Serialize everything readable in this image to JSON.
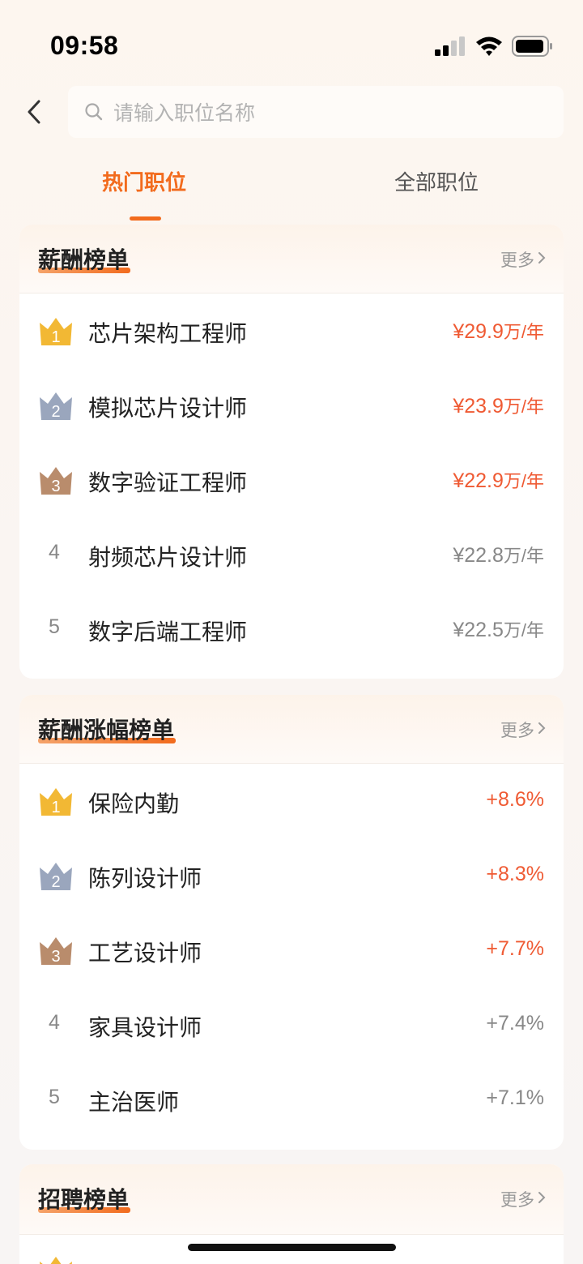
{
  "status_bar": {
    "time": "09:58"
  },
  "search": {
    "placeholder": "请输入职位名称"
  },
  "tabs": [
    {
      "label": "热门职位",
      "active": true
    },
    {
      "label": "全部职位",
      "active": false
    }
  ],
  "colors": {
    "accent": "#f26b1d",
    "value_hot": "#ef5a33",
    "gold": "#f2b834",
    "silver": "#9aa6bd",
    "bronze": "#b98c6c"
  },
  "salary_board": {
    "title": "薪酬榜单",
    "more": "更多",
    "items": [
      {
        "rank": "1",
        "name": "芯片架构工程师",
        "value": "¥29.9",
        "unit": "万/年"
      },
      {
        "rank": "2",
        "name": "模拟芯片设计师",
        "value": "¥23.9",
        "unit": "万/年"
      },
      {
        "rank": "3",
        "name": "数字验证工程师",
        "value": "¥22.9",
        "unit": "万/年"
      },
      {
        "rank": "4",
        "name": "射频芯片设计师",
        "value": "¥22.8",
        "unit": "万/年"
      },
      {
        "rank": "5",
        "name": "数字后端工程师",
        "value": "¥22.5",
        "unit": "万/年"
      }
    ]
  },
  "growth_board": {
    "title": "薪酬涨幅榜单",
    "more": "更多",
    "items": [
      {
        "rank": "1",
        "name": "保险内勤",
        "value": "+8.6%"
      },
      {
        "rank": "2",
        "name": "陈列设计师",
        "value": "+8.3%"
      },
      {
        "rank": "3",
        "name": "工艺设计师",
        "value": "+7.7%"
      },
      {
        "rank": "4",
        "name": "家具设计师",
        "value": "+7.4%"
      },
      {
        "rank": "5",
        "name": "主治医师",
        "value": "+7.1%"
      }
    ]
  },
  "hiring_board": {
    "title": "招聘榜单",
    "more": "更多"
  }
}
